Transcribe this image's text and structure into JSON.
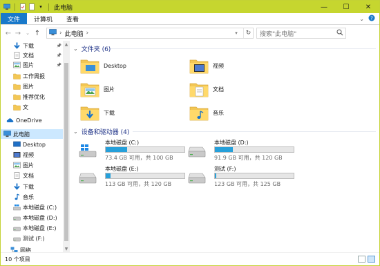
{
  "window": {
    "title": "此电脑",
    "controls": {
      "minimize": "—",
      "maximize": "☐",
      "close": "✕"
    }
  },
  "ribbon": {
    "tabs": [
      {
        "label": "文件",
        "active": true
      },
      {
        "label": "计算机",
        "active": false
      },
      {
        "label": "查看",
        "active": false
      }
    ]
  },
  "address": {
    "path": "此电脑",
    "separator": "›",
    "search_placeholder": "搜索\"此电脑\""
  },
  "nav": {
    "items": [
      {
        "label": "下载",
        "icon": "download-arrow-icon",
        "pinned": true
      },
      {
        "label": "文档",
        "icon": "document-icon",
        "pinned": true
      },
      {
        "label": "图片",
        "icon": "picture-icon",
        "pinned": true
      },
      {
        "label": "工作周报",
        "icon": "folder-icon",
        "pinned": false
      },
      {
        "label": "图片",
        "icon": "folder-icon",
        "pinned": false
      },
      {
        "label": "推荐优化",
        "icon": "folder-icon",
        "pinned": false
      },
      {
        "label": "文",
        "icon": "folder-icon",
        "pinned": false
      },
      {
        "label": "OneDrive",
        "icon": "cloud-icon",
        "pinned": false
      },
      {
        "label": "此电脑",
        "icon": "computer-icon",
        "pinned": false,
        "selected": true
      },
      {
        "label": "Desktop",
        "icon": "desktop-icon",
        "pinned": false
      },
      {
        "label": "视频",
        "icon": "video-icon",
        "pinned": false
      },
      {
        "label": "图片",
        "icon": "picture-icon",
        "pinned": false
      },
      {
        "label": "文档",
        "icon": "document-icon",
        "pinned": false
      },
      {
        "label": "下载",
        "icon": "download-arrow-icon",
        "pinned": false
      },
      {
        "label": "音乐",
        "icon": "music-icon",
        "pinned": false
      },
      {
        "label": "本地磁盘 (C:)",
        "icon": "drive-c-icon",
        "pinned": false
      },
      {
        "label": "本地磁盘 (D:)",
        "icon": "drive-icon",
        "pinned": false
      },
      {
        "label": "本地磁盘 (E:)",
        "icon": "drive-icon",
        "pinned": false
      },
      {
        "label": "测试 (F:)",
        "icon": "drive-icon",
        "pinned": false
      },
      {
        "label": "网络",
        "icon": "network-icon",
        "pinned": false
      }
    ]
  },
  "folders": {
    "header": "文件夹 (6)",
    "items": [
      {
        "label": "Desktop",
        "icon": "desktop-folder-icon"
      },
      {
        "label": "视频",
        "icon": "video-folder-icon"
      },
      {
        "label": "图片",
        "icon": "picture-folder-icon"
      },
      {
        "label": "文档",
        "icon": "document-folder-icon"
      },
      {
        "label": "下载",
        "icon": "download-folder-icon"
      },
      {
        "label": "音乐",
        "icon": "music-folder-icon"
      }
    ]
  },
  "drives": {
    "header": "设备和驱动器 (4)",
    "items": [
      {
        "label": "本地磁盘 (C:)",
        "info": "73.4 GB 可用，共 100 GB",
        "used_fraction": 0.27,
        "icon": "windows-drive-icon"
      },
      {
        "label": "本地磁盘 (D:)",
        "info": "91.9 GB 可用，共 120 GB",
        "used_fraction": 0.23,
        "icon": "hard-drive-icon"
      },
      {
        "label": "本地磁盘 (E:)",
        "info": "113 GB 可用，共 120 GB",
        "used_fraction": 0.06,
        "icon": "hard-drive-icon"
      },
      {
        "label": "测试 (F:)",
        "info": "123 GB 可用，共 125 GB",
        "used_fraction": 0.02,
        "icon": "hard-drive-icon"
      }
    ]
  },
  "status": {
    "count": "10 个项目"
  },
  "colors": {
    "titlebar": "#c6d62f",
    "accent": "#1979ca",
    "drive_bar": "#26a0da",
    "folder": "#f3c755"
  }
}
